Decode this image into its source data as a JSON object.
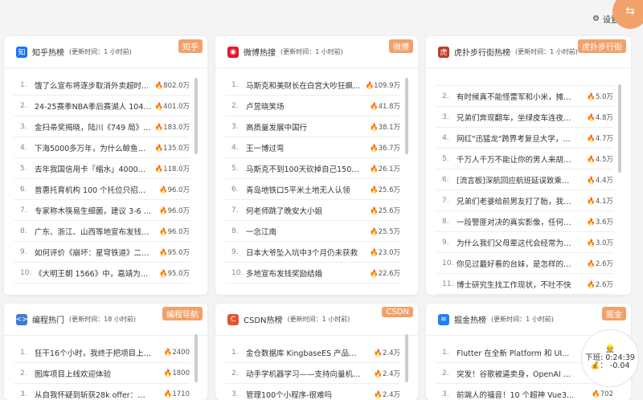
{
  "topbar": {
    "settings_label": "设置",
    "settings_icon": "gear-icon",
    "fab_icon": "swap-icon",
    "fab_glyph": "⇆"
  },
  "cards": [
    {
      "id": "zhihu",
      "title": "知乎热榜",
      "subtitle": "(更新时间：1 小时前)",
      "badge": "知乎",
      "logo": "知",
      "logo_color": "#1772f6",
      "items": [
        [
          "1.",
          "饿了么宣布将逐步取消外卖超时...",
          "802.0万"
        ],
        [
          "2.",
          "24-25赛季NBA季后赛湖人 104:11...",
          "401.0万"
        ],
        [
          "3.",
          "金扫帚奖揭晓，陆川《749 局》横...",
          "183.0万"
        ],
        [
          "4.",
          "下海5000多万年，为什么鲸鱼没...",
          "135.0万"
        ],
        [
          "5.",
          "去年我国信用卡「缩水」4000万...",
          "118.0万"
        ],
        [
          "6.",
          "普惠托育机构 100 个托位只招到 17...",
          "96.0万"
        ],
        [
          "7.",
          "专家称木筷易生细菌，建议 3-6 个...",
          "96.0万"
        ],
        [
          "8.",
          "广东、浙江、山西等地宣布发钱奖...",
          "96.0万"
        ],
        [
          "9.",
          "如何评价《崩坏：星穹铁道》二周...",
          "95.0万"
        ],
        [
          "10.",
          "《大明王朝 1566》中，嘉靖为什...",
          "95.0万"
        ]
      ]
    },
    {
      "id": "weibo",
      "title": "微博热搜",
      "subtitle": "(更新时间：1 小时前)",
      "badge": "微博",
      "logo": "◉",
      "logo_color": "#e6162d",
      "items": [
        [
          "1.",
          "马斯克和美财长在白宫大吵狂飙脏...",
          "109.9万"
        ],
        [
          "2.",
          "卢昱晓笑场",
          "41.8万"
        ],
        [
          "3.",
          "高质量发展中国行",
          "38.1万"
        ],
        [
          "4.",
          "王一博过弯",
          "36.7万"
        ],
        [
          "5.",
          "马斯克不到100天砍掉自己1500亿...",
          "26.1万"
        ],
        [
          "6.",
          "青岛地铁口5平米土地无人认领",
          "25.6万"
        ],
        [
          "7.",
          "何老师跳了晚安大小姐",
          "25.6万"
        ],
        [
          "8.",
          "一念江南",
          "25.5万"
        ],
        [
          "9.",
          "日本大爷坠入坑中3个月仍未获救",
          "23.0万"
        ],
        [
          "10.",
          "多地宣布发钱奖励结婚",
          "22.6万"
        ]
      ]
    },
    {
      "id": "hupu",
      "title": "虎扑步行街热榜",
      "subtitle": "(更新时间：1 小时前)",
      "badge": "虎扑步行街",
      "logo": "虎",
      "logo_color": "#c0392b",
      "items": [
        [
          "2.",
          "有时候真不能怪雷军和小米，摊上这...",
          "5.0万"
        ],
        [
          "3.",
          "兄弟们奔现翻车，坐绿皮车连夜跑路...",
          "4.8万"
        ],
        [
          "4.",
          "网红\"迅猛龙\"跨界考复旦大学，公平...",
          "4.7万"
        ],
        [
          "5.",
          "千万人千万不能让你的男人来胡志明...",
          "4.5万"
        ],
        [
          "6.",
          "[流言板]深航回应航班延误致乘客被...",
          "4.4万"
        ],
        [
          "7.",
          "兄弟们老婆给前男友打了胎，我刚知...",
          "4.1万"
        ],
        [
          "8.",
          "一段警匪对决的真实影像，任何电影...",
          "3.6万"
        ],
        [
          "9.",
          "为什么我们父母辈这代会经常为了一...",
          "3.0万"
        ],
        [
          "10.",
          "你见过最好看的台妹，是怎样的？可...",
          "2.6万"
        ],
        [
          "11.",
          "博士研究生找工作现状，不吐不快",
          "2.6万"
        ]
      ]
    },
    {
      "id": "coding",
      "title": "编程热门",
      "subtitle": "(更新时间：18 小时前)",
      "badge": "编程导航",
      "logo": "<>",
      "logo_color": "#3a7bd5",
      "items": [
        [
          "1.",
          "狂干16个小时，我终于把项目上线...",
          "2400"
        ],
        [
          "2.",
          "图库项目上线欢迎体验",
          "1800"
        ],
        [
          "3.",
          "从自我怀疑到斩获28k offer：一个普...",
          "1710"
        ]
      ]
    },
    {
      "id": "csdn",
      "title": "CSDN热榜",
      "subtitle": "(更新时间：1 小时前)",
      "badge": "CSDN",
      "logo": "C",
      "logo_color": "#e8522f",
      "items": [
        [
          "1.",
          "金仓数据库 KingbaseES 产品深度优...",
          "2.4万"
        ],
        [
          "2.",
          "动手学机器学习——支持向量机SVM...",
          "2.4万"
        ],
        [
          "3.",
          "管理100个小程序-很难吗",
          "2.4万"
        ]
      ]
    },
    {
      "id": "juejin",
      "title": "掘金热榜",
      "subtitle": "(更新时间：1 小时前)",
      "badge": "掘金",
      "logo": "≋",
      "logo_color": "#1e80ff",
      "items": [
        [
          "1.",
          "Flutter 在全新 Platform 和 UI...",
          ""
        ],
        [
          "2.",
          "突发！谷歌被逼卖身，OpenAI 趁机收...",
          ""
        ],
        [
          "3.",
          "前端人的福音！10 个超神 Vue3 实战...",
          "702"
        ]
      ]
    }
  ],
  "timer": {
    "icon": "worker-icon",
    "off_work_label": "下班:",
    "off_work_value": "0:24:39",
    "money_icon": "money-bag-icon",
    "money_sep": "：",
    "money_value": "-0.04"
  }
}
